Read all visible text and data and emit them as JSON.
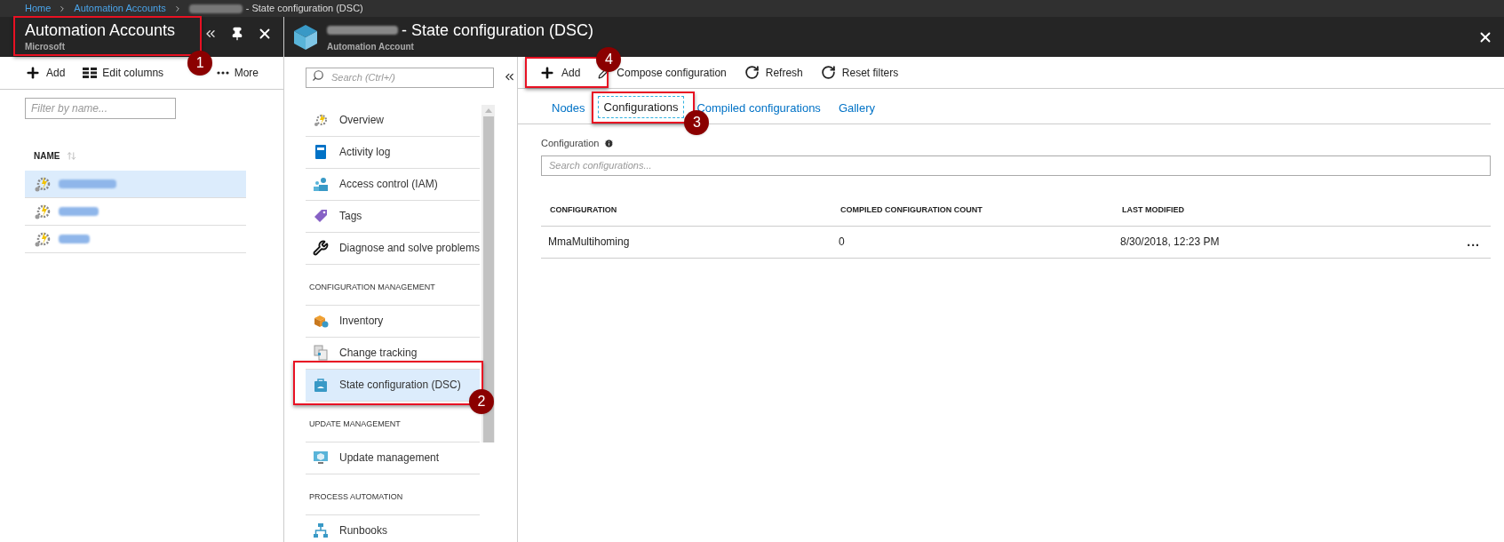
{
  "breadcrumb": [
    {
      "kind": "link",
      "label": "Home"
    },
    {
      "kind": "link",
      "label": "Automation Accounts"
    },
    {
      "kind": "redacted"
    },
    {
      "kind": "text",
      "label": "- State configuration (DSC)"
    }
  ],
  "accounts_blade": {
    "title": "Automation Accounts",
    "subtitle": "Microsoft",
    "callout": "1",
    "toolbar": [
      {
        "kind": "add",
        "label": "Add"
      },
      {
        "kind": "columns",
        "label": "Edit columns"
      },
      {
        "kind": "more",
        "label": "More"
      }
    ],
    "filter": {
      "placeholder": "Filter by name..."
    },
    "column": "NAME",
    "rows": [
      {
        "selected": true
      },
      {
        "selected": false
      },
      {
        "selected": false
      }
    ]
  },
  "resource_blade": {
    "title_suffix": "- State configuration (DSC)",
    "subtitle": "Automation Account",
    "search": {
      "placeholder": "Search (Ctrl+/)"
    },
    "menu": [
      {
        "kind": "item",
        "label": "Overview",
        "selected": false
      },
      {
        "kind": "item",
        "label": "Activity log",
        "selected": false
      },
      {
        "kind": "item",
        "label": "Access control (IAM)",
        "selected": false
      },
      {
        "kind": "item",
        "label": "Tags",
        "selected": false
      },
      {
        "kind": "item",
        "label": "Diagnose and solve problems",
        "selected": false
      },
      {
        "kind": "section",
        "label": "CONFIGURATION MANAGEMENT"
      },
      {
        "kind": "item",
        "label": "Inventory",
        "selected": false
      },
      {
        "kind": "item",
        "label": "Change tracking",
        "selected": false
      },
      {
        "kind": "item",
        "label": "State configuration (DSC)",
        "selected": true,
        "callout": "2"
      },
      {
        "kind": "section",
        "label": "UPDATE MANAGEMENT"
      },
      {
        "kind": "item",
        "label": "Update management",
        "selected": false
      },
      {
        "kind": "section",
        "label": "PROCESS AUTOMATION"
      },
      {
        "kind": "item",
        "label": "Runbooks",
        "selected": false
      }
    ]
  },
  "content": {
    "toolbar": [
      {
        "kind": "add",
        "label": "Add",
        "callout": "4"
      },
      {
        "kind": "compose",
        "label": "Compose configuration"
      },
      {
        "kind": "refresh",
        "label": "Refresh"
      },
      {
        "kind": "refresh",
        "label": "Reset filters"
      }
    ],
    "tabs": [
      {
        "label": "Nodes",
        "selected": false
      },
      {
        "label": "Configurations",
        "selected": true,
        "callout": "3"
      },
      {
        "label": "Compiled configurations",
        "selected": false
      },
      {
        "label": "Gallery",
        "selected": false
      }
    ],
    "filter_label": "Configuration",
    "search": {
      "placeholder": "Search configurations..."
    },
    "table": {
      "columns": [
        "CONFIGURATION",
        "COMPILED CONFIGURATION COUNT",
        "LAST MODIFIED"
      ],
      "rows": [
        {
          "cells": [
            "MmaMultihoming",
            "0",
            "8/30/2018, 12:23 PM"
          ],
          "more": "..."
        }
      ]
    }
  }
}
